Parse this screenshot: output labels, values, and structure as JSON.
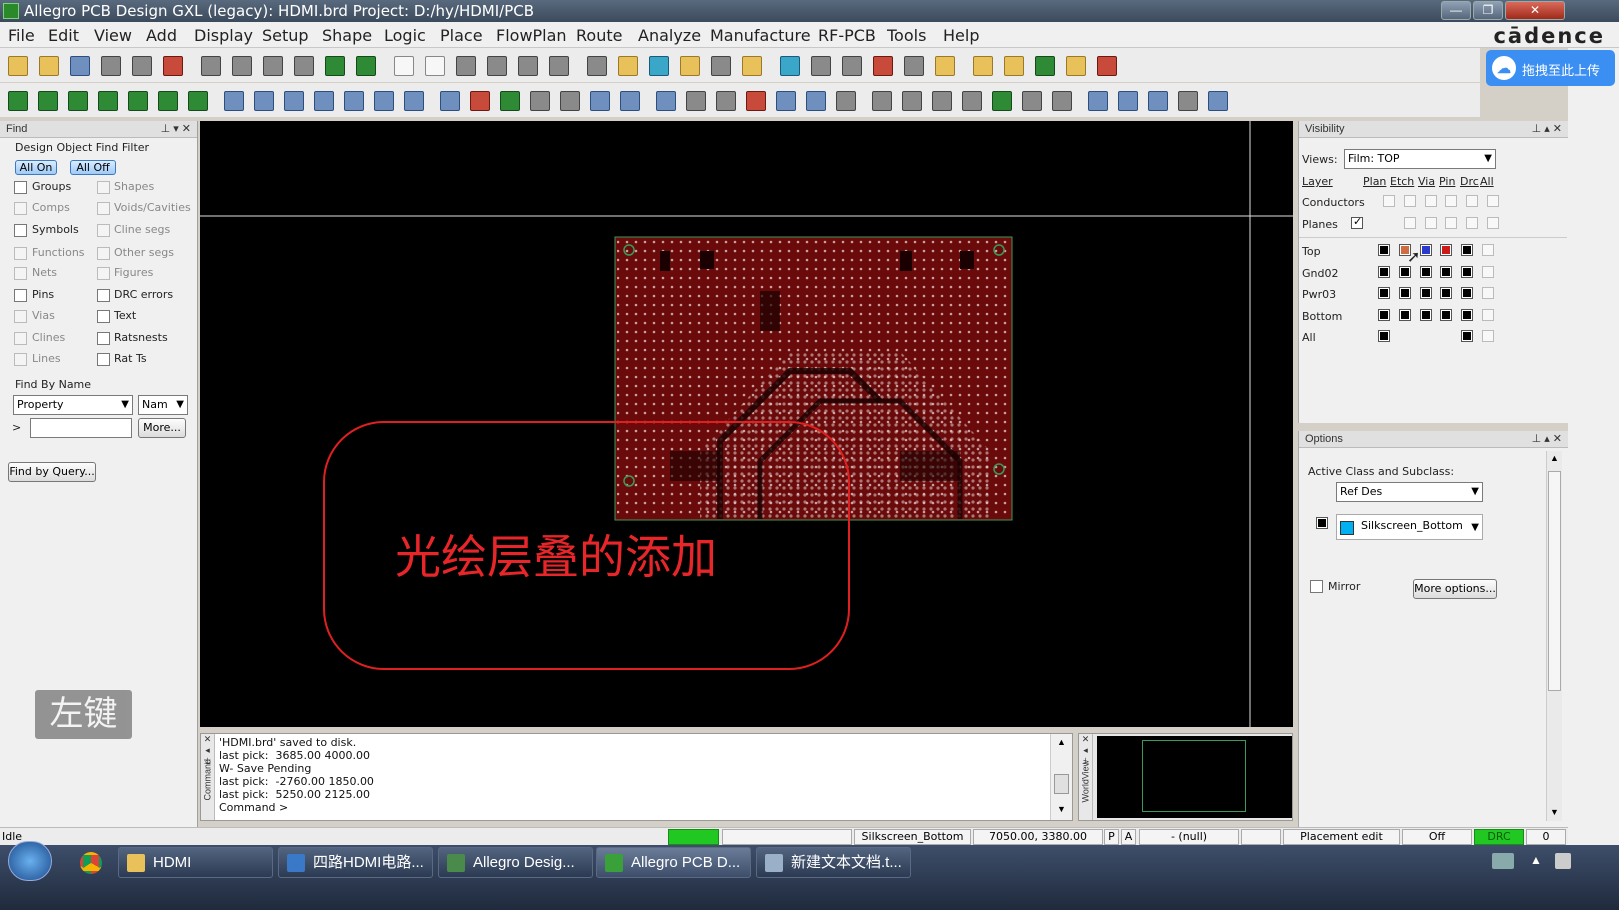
{
  "window": {
    "title": "Allegro PCB Design GXL (legacy): HDMI.brd  Project: D:/hy/HDMI/PCB"
  },
  "menu": [
    "File",
    "Edit",
    "View",
    "Add",
    "Display",
    "Setup",
    "Shape",
    "Logic",
    "Place",
    "FlowPlan",
    "Route",
    "Analyze",
    "Manufacture",
    "RF-PCB",
    "Tools",
    "Help"
  ],
  "brand": "cādence",
  "upload_label": "拖拽至此上传",
  "find": {
    "title": "Find",
    "filter_title": "Design Object Find Filter",
    "all_on": "All On",
    "all_off": "All Off",
    "left": [
      {
        "label": "Groups",
        "enabled": true
      },
      {
        "label": "Comps",
        "enabled": false
      },
      {
        "label": "Symbols",
        "enabled": true
      },
      {
        "label": "Functions",
        "enabled": false
      },
      {
        "label": "Nets",
        "enabled": false
      },
      {
        "label": "Pins",
        "enabled": true
      },
      {
        "label": "Vias",
        "enabled": false
      },
      {
        "label": "Clines",
        "enabled": false
      },
      {
        "label": "Lines",
        "enabled": false
      }
    ],
    "right": [
      {
        "label": "Shapes",
        "enabled": false
      },
      {
        "label": "Voids/Cavities",
        "enabled": false
      },
      {
        "label": "Cline segs",
        "enabled": false
      },
      {
        "label": "Other segs",
        "enabled": false
      },
      {
        "label": "Figures",
        "enabled": false
      },
      {
        "label": "DRC errors",
        "enabled": true
      },
      {
        "label": "Text",
        "enabled": true
      },
      {
        "label": "Ratsnests",
        "enabled": true
      },
      {
        "label": "Rat Ts",
        "enabled": true
      }
    ],
    "by_name": "Find By Name",
    "property": "Property",
    "name": "Nam",
    "prompt": ">",
    "more": "More...",
    "query": "Find by Query..."
  },
  "overlay": {
    "caption": "光绘层叠的添加",
    "left_key": "左键"
  },
  "command": {
    "lines": [
      "'HDMI.brd' saved to disk.",
      "last pick:  3685.00 4000.00",
      "W- Save Pending",
      "last pick:  -2760.00 1850.00",
      "last pick:  5250.00 2125.00",
      "Command >"
    ],
    "side_label": "Command",
    "world_label": "WorldView"
  },
  "visibility": {
    "title": "Visibility",
    "views_label": "Views:",
    "views_value": "Film: TOP",
    "layer_hdr": "Layer",
    "cols": [
      "Plan",
      "Etch",
      "Via",
      "Pin",
      "Drc",
      "All"
    ],
    "rows": [
      {
        "name": "Conductors"
      },
      {
        "name": "Planes"
      },
      {
        "name": "Top"
      },
      {
        "name": "Gnd02"
      },
      {
        "name": "Pwr03"
      },
      {
        "name": "Bottom"
      },
      {
        "name": "All"
      }
    ]
  },
  "options": {
    "title": "Options",
    "active_label": "Active Class and Subclass:",
    "class_value": "Ref Des",
    "subclass_value": "Silkscreen_Bottom",
    "subclass_color": "#00b0f0",
    "mirror": "Mirror",
    "more": "More options..."
  },
  "status": {
    "idle": "Idle",
    "subclass": "Silkscreen_Bottom",
    "coords": "7050.00, 3380.00",
    "p": "P",
    "a": "A",
    "null": "- (null)",
    "mode": "Placement edit",
    "off": "Off",
    "drc": "DRC",
    "count": "0"
  },
  "taskbar": [
    {
      "label": "HDMI",
      "color": "#e8c15a"
    },
    {
      "label": "四路HDMI电路...",
      "color": "#3a78c8"
    },
    {
      "label": "Allegro Desig...",
      "color": "#4a8a4a"
    },
    {
      "label": "Allegro PCB D...",
      "color": "#3aa03a"
    },
    {
      "label": "新建文本文档.t...",
      "color": "#9ab0c8"
    }
  ]
}
